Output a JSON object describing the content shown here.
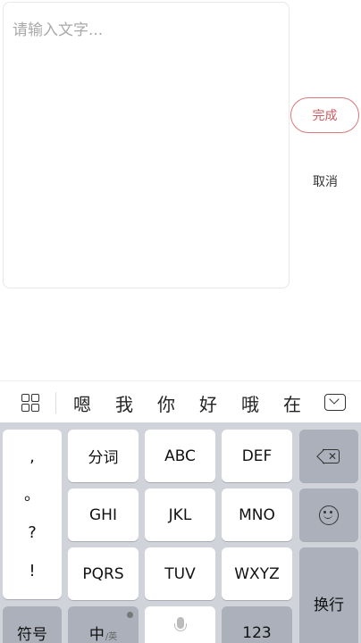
{
  "editor": {
    "placeholder": "请输入文字..."
  },
  "actions": {
    "done_label": "完成",
    "cancel_label": "取消",
    "accent_color": "#d15a5f"
  },
  "candidates": {
    "words": [
      "嗯",
      "我",
      "你",
      "好",
      "哦",
      "在"
    ]
  },
  "keyboard": {
    "punctuation": [
      ",",
      "。",
      "?",
      "!"
    ],
    "row1": [
      "分词",
      "ABC",
      "DEF"
    ],
    "row2": [
      "GHI",
      "JKL",
      "MNO"
    ],
    "row3": [
      "PQRS",
      "TUV",
      "WXYZ"
    ],
    "symbol_label": "符号",
    "lang_main": "中",
    "lang_sub": "/英",
    "number_label": "123",
    "enter_label": "换行"
  },
  "icons": {
    "menu": "grid-icon",
    "collapse": "collapse-keyboard-icon",
    "backspace": "backspace-icon",
    "emoji": "emoji-icon",
    "voice": "microphone-icon"
  }
}
